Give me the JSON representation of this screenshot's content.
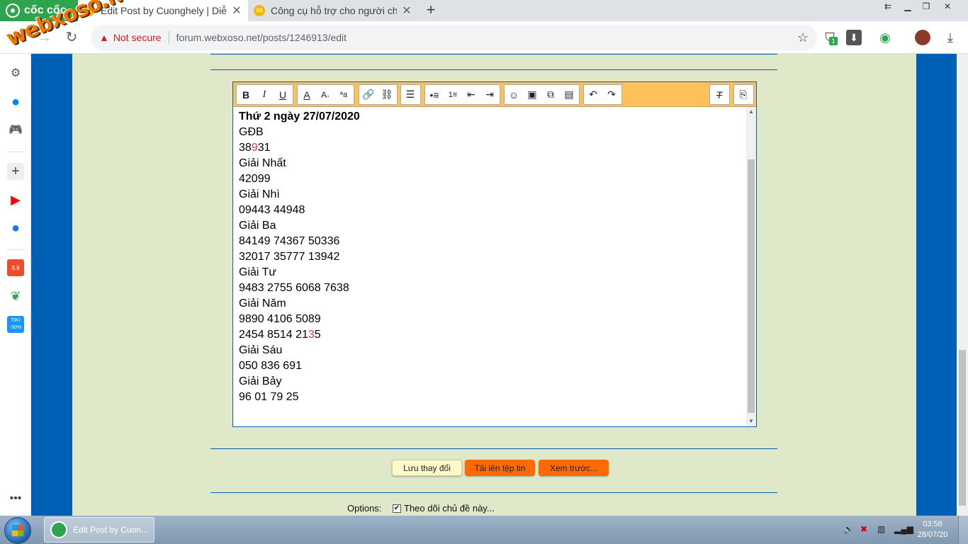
{
  "browser": {
    "brand": "cốc cốc",
    "tabs": [
      {
        "title": "Edit Post by Cuonghely | Diễn",
        "favicon": "XS"
      },
      {
        "title": "Công cụ hỗ trợ cho người chơ",
        "favicon": "XS"
      }
    ],
    "security": "Not secure",
    "url": "forum.webxoso.net/posts/1246913/edit",
    "badge": "1"
  },
  "watermark": "webxoso.net",
  "sidebar": {
    "badge_sale": "8.8",
    "badge_tiki": "TIKI",
    "badge_discount": "-50%"
  },
  "editor": {
    "lines": [
      "Thứ 2 ngày 27/07/2020",
      "GĐB",
      "",
      "Giải Nhất",
      "42099",
      "Giải Nhì",
      "09443 44948",
      "Giải Ba",
      "84149 74367 50336",
      "32017 35777 13942",
      "Giải Tư",
      "9483 2755 6068 7638",
      "Giải Năm",
      "9890 4106 5089",
      "",
      "Giải Sáu",
      "050 836 691",
      "Giải Bảy",
      "96 01 79 25"
    ],
    "gdb_parts": [
      "38",
      "9",
      "31"
    ],
    "g5b_parts": [
      "2454 8514 21",
      "3",
      "5"
    ]
  },
  "buttons": {
    "save": "Lưu thay đổi",
    "upload": "Tải lên tệp tin",
    "preview": "Xem trước..."
  },
  "options": {
    "label": "Options:",
    "watch": "Theo dõi chủ đề này..."
  },
  "taskbar": {
    "item": "Edit Post by Cuon...",
    "time": "03:58",
    "date": "28/07/20"
  },
  "colors": {
    "page_bg": "#dfe8c9",
    "frame_blue": "#0060b6",
    "toolbar_orange": "#fcc15b",
    "button_orange": "#ff6a00",
    "highlight": "#e0308a"
  }
}
